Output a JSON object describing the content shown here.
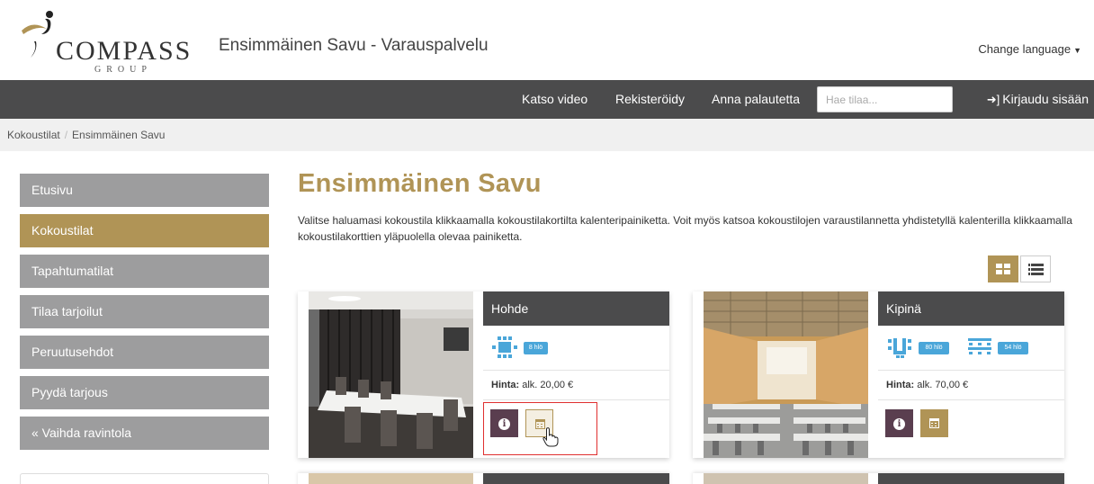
{
  "brand": {
    "logo_text": "COMPASS",
    "logo_sub": "GROUP",
    "site_title": "Ensimmäinen Savu - Varauspalvelu"
  },
  "header": {
    "change_language": "Change language"
  },
  "nav": {
    "items": [
      "Katso video",
      "Rekisteröidy",
      "Anna palautetta"
    ],
    "search_placeholder": "Hae tilaa...",
    "login": "Kirjaudu sisään"
  },
  "breadcrumb": {
    "items": [
      "Kokoustilat",
      "Ensimmäinen Savu"
    ]
  },
  "sidebar": {
    "items": [
      "Etusivu",
      "Kokoustilat",
      "Tapahtumatilat",
      "Tilaa tarjoilut",
      "Peruutusehdot",
      "Pyydä tarjous",
      "« Vaihda ravintola"
    ],
    "active": "Kokoustilat"
  },
  "main": {
    "title": "Ensimmäinen Savu",
    "intro": "Valitse haluamasi kokoustila klikkaamalla kokoustilakortilta kalenteripainiketta. Voit myös katsoa kokoustilojen varaustilannetta yhdistetyllä kalenterilla klikkaamalla kokoustilakorttien yläpuolella olevaa painiketta."
  },
  "rooms": [
    {
      "name": "Hohde",
      "capacities": [
        "8 hlö"
      ],
      "price_label": "Hinta:",
      "price": "alk. 20,00 €"
    },
    {
      "name": "Kipinä",
      "capacities": [
        "80 hlö",
        "54 hlö"
      ],
      "price_label": "Hinta:",
      "price": "alk. 70,00 €"
    }
  ],
  "icons": {
    "view_grid": "grid-icon",
    "view_list": "list-icon",
    "info": "info-icon",
    "calendar": "calendar-icon",
    "login": "sign-in-icon",
    "caret": "caret-down-icon"
  },
  "colors": {
    "gold": "#b09456",
    "nav_bg": "#4b4b4c",
    "sidebar_bg": "#9d9d9e",
    "info_btn": "#5a3e4f",
    "capacity_blue": "#4aa6d9",
    "highlight_red": "#e03030"
  }
}
